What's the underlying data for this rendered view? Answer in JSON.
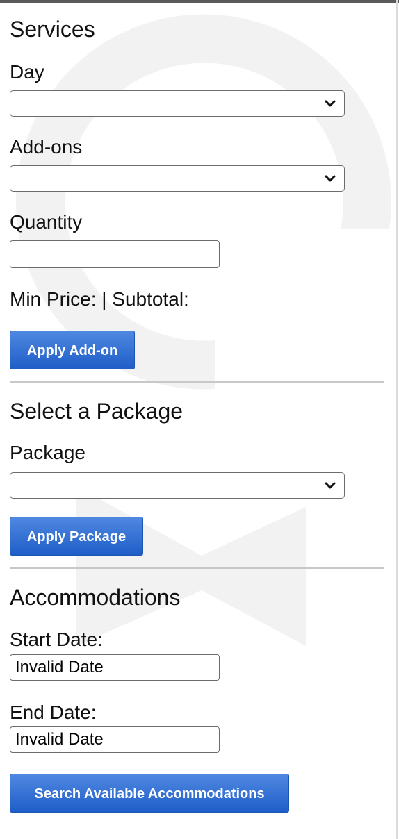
{
  "services": {
    "title": "Services",
    "day_label": "Day",
    "day_value": "",
    "addons_label": "Add-ons",
    "addons_value": "",
    "quantity_label": "Quantity",
    "quantity_value": "",
    "price_summary": "Min Price: | Subtotal:",
    "apply_addon_label": "Apply Add-on"
  },
  "package": {
    "title": "Select a Package",
    "package_label": "Package",
    "package_value": "",
    "apply_package_label": "Apply Package"
  },
  "accommodations": {
    "title": "Accommodations",
    "start_label": "Start Date:",
    "start_value": "Invalid Date",
    "end_label": "End Date:",
    "end_value": "Invalid Date",
    "search_label": "Search Available Accommodations"
  },
  "icons": {
    "dropdown": "chevron-down-icon",
    "watermark": "logo-watermark"
  },
  "colors": {
    "button_blue": "#2a67cf",
    "border_gray": "#6b6b6b",
    "divider_gray": "#c8c8c8",
    "top_bar": "#5a5a5a"
  }
}
